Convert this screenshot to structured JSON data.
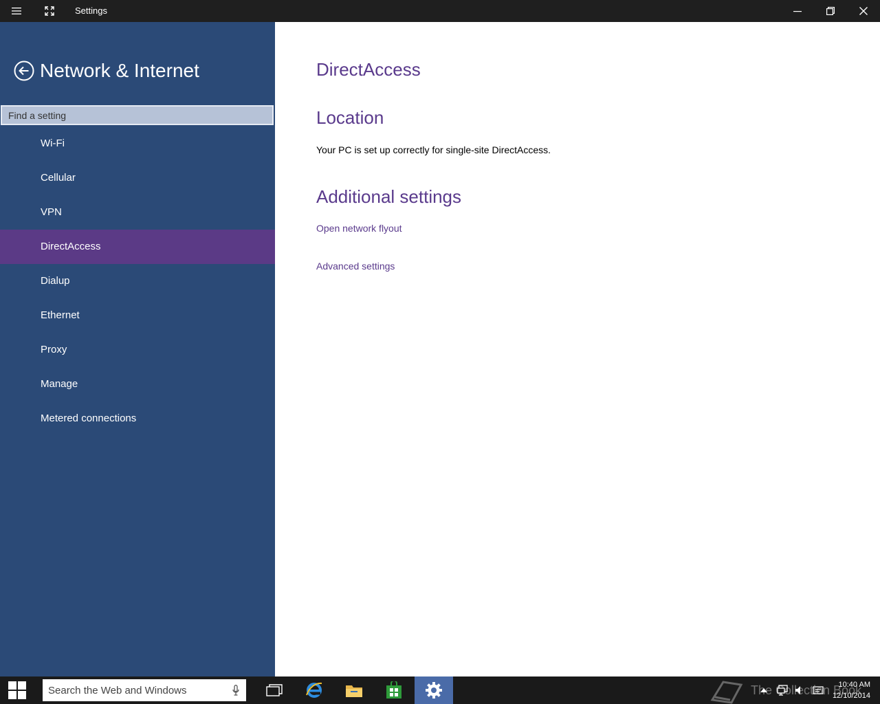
{
  "window": {
    "title": "Settings",
    "controls": {
      "menu": "menu",
      "expand": "expand",
      "minimize": "minimize",
      "restore": "restore",
      "close": "close"
    }
  },
  "sidebar": {
    "title": "Network & Internet",
    "search_placeholder": "Find a setting",
    "items": [
      {
        "label": "Wi-Fi",
        "active": false
      },
      {
        "label": "Cellular",
        "active": false
      },
      {
        "label": "VPN",
        "active": false
      },
      {
        "label": "DirectAccess",
        "active": true
      },
      {
        "label": "Dialup",
        "active": false
      },
      {
        "label": "Ethernet",
        "active": false
      },
      {
        "label": "Proxy",
        "active": false
      },
      {
        "label": "Manage",
        "active": false
      },
      {
        "label": "Metered connections",
        "active": false
      }
    ]
  },
  "main": {
    "page_title": "DirectAccess",
    "location": {
      "heading": "Location",
      "text": "Your PC is set up correctly for single-site DirectAccess."
    },
    "additional": {
      "heading": "Additional settings",
      "links": [
        "Open network flyout",
        "Advanced settings"
      ]
    }
  },
  "taskbar": {
    "search_placeholder": "Search the Web and Windows",
    "time": "10:40 AM",
    "date": "12/10/2014",
    "watermark": "The Collection Book"
  },
  "colors": {
    "sidebar_bg": "#2b4a77",
    "active_item": "#5b3a86",
    "accent_text": "#5a3a8c",
    "titlebar_bg": "#1f1f1f",
    "taskbar_bg": "#1a1a1a"
  }
}
